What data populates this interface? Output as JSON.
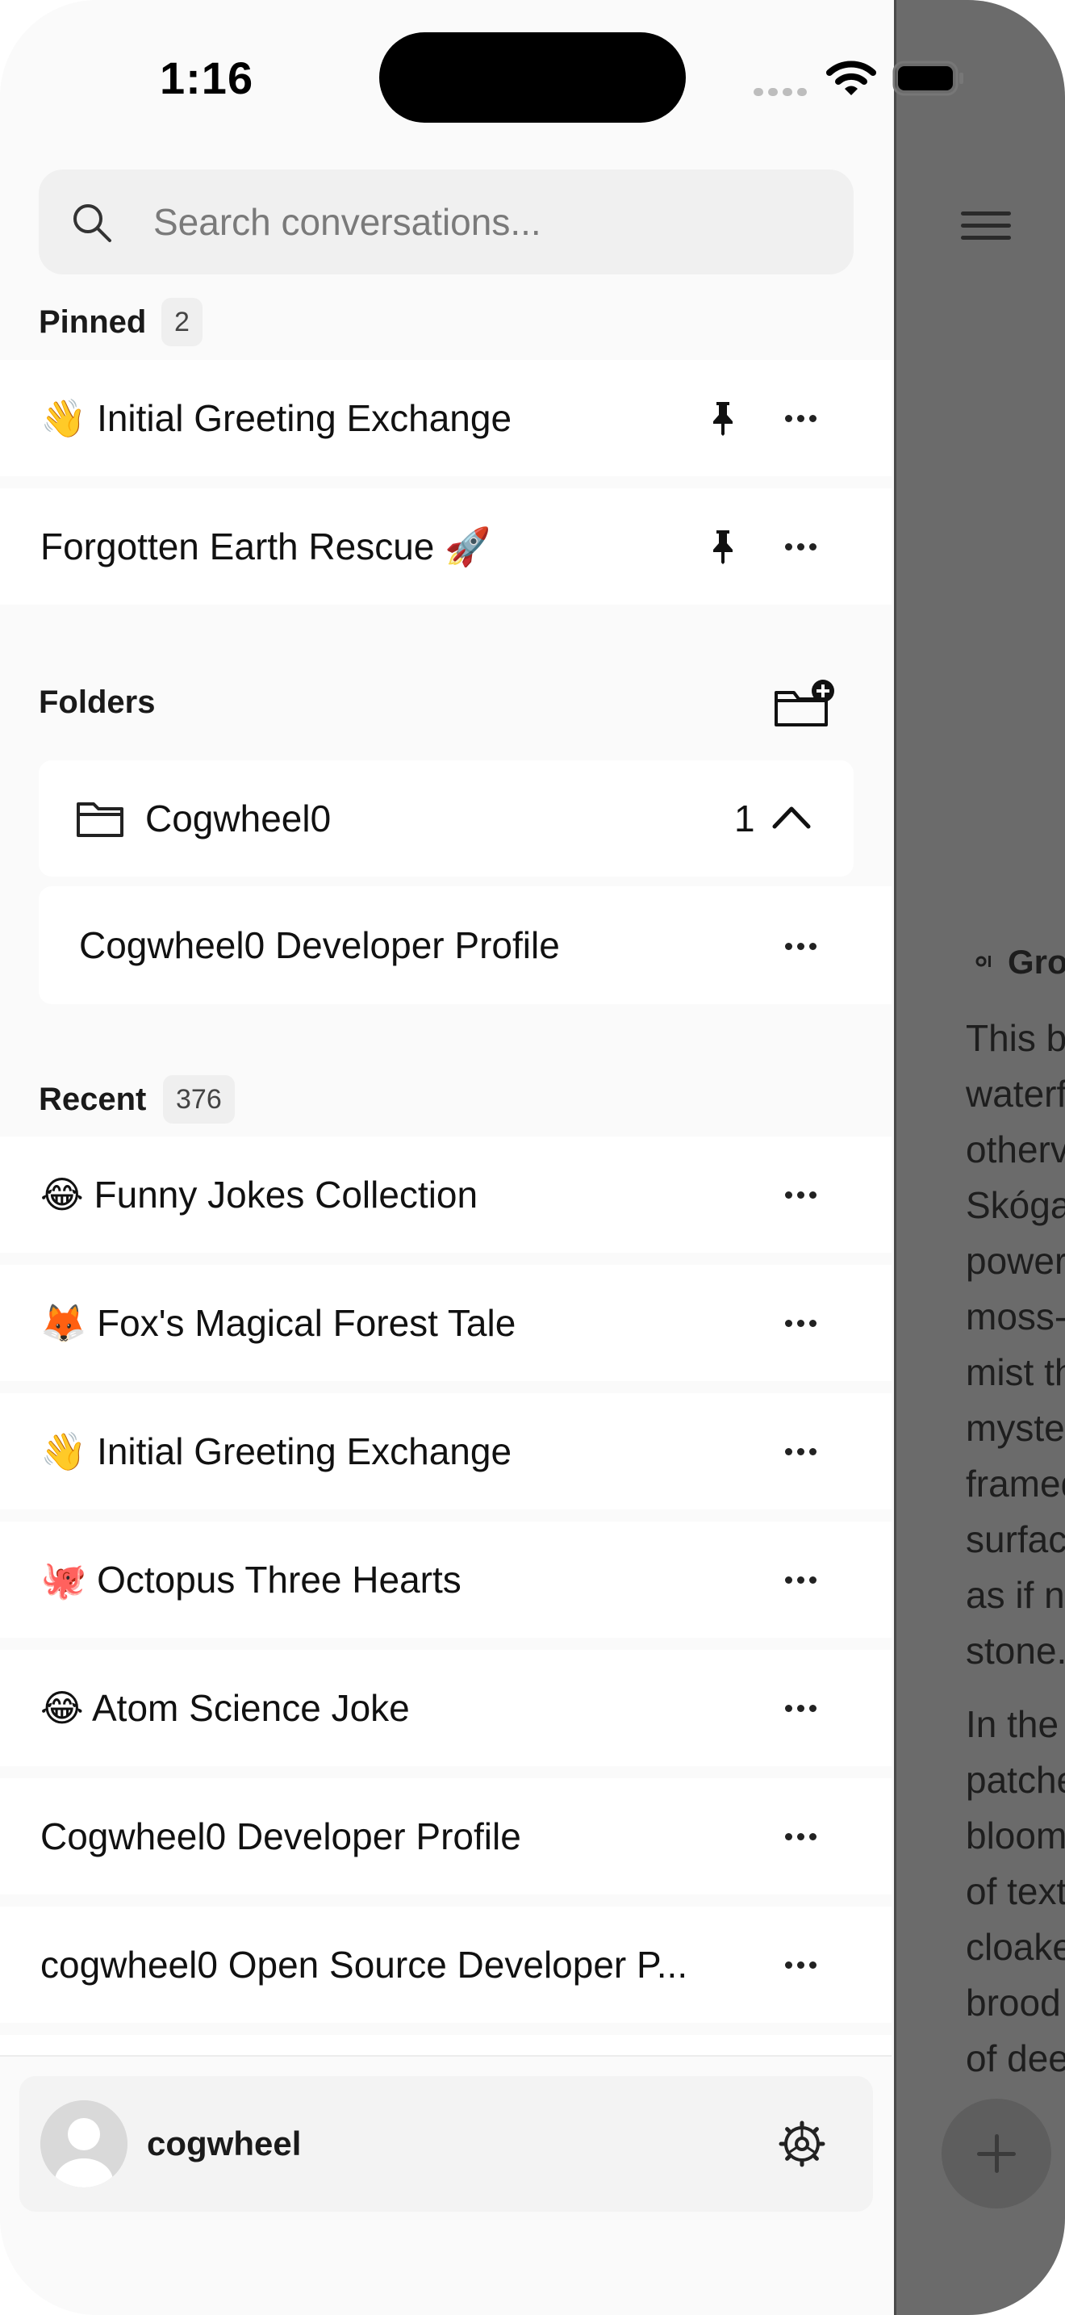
{
  "status_bar": {
    "time": "1:16"
  },
  "search": {
    "placeholder": "Search conversations..."
  },
  "pinned": {
    "label": "Pinned",
    "count": "2",
    "items": [
      {
        "emoji": "👋",
        "title": "Initial Greeting Exchange"
      },
      {
        "title": "Forgotten Earth Rescue 🚀"
      }
    ]
  },
  "folders": {
    "label": "Folders",
    "items": [
      {
        "name": "Cogwheel0",
        "count": "1",
        "expanded": true,
        "children": [
          {
            "title": "Cogwheel0 Developer Profile"
          }
        ]
      }
    ]
  },
  "recent": {
    "label": "Recent",
    "count": "376",
    "items": [
      {
        "emoji": "😂",
        "title": "Funny Jokes Collection"
      },
      {
        "emoji": "🦊",
        "title": "Fox's Magical Forest Tale"
      },
      {
        "emoji": "👋",
        "title": "Initial Greeting Exchange"
      },
      {
        "emoji": "🐙",
        "title": "Octopus Three Hearts"
      },
      {
        "emoji": "😂",
        "title": "Atom Science Joke"
      },
      {
        "title": "Cogwheel0 Developer Profile"
      },
      {
        "title": "cogwheel0 Open Source Developer P..."
      }
    ]
  },
  "user": {
    "name": "cogwheel"
  },
  "main": {
    "heading": "Gro",
    "lines": [
      "This b",
      "waterf",
      "otherv",
      "Skóga",
      "power",
      "moss-",
      "mist th",
      "myste",
      "framed",
      "surfac",
      "as if n",
      "stone."
    ],
    "lines2": [
      "In the",
      "patche",
      "bloom",
      "of text",
      "cloake",
      "brood",
      "of dee"
    ]
  },
  "colors": {
    "dim_overlay": "#6b6b6b",
    "sidebar_bg": "#fafafa",
    "row_bg": "#ffffff"
  }
}
